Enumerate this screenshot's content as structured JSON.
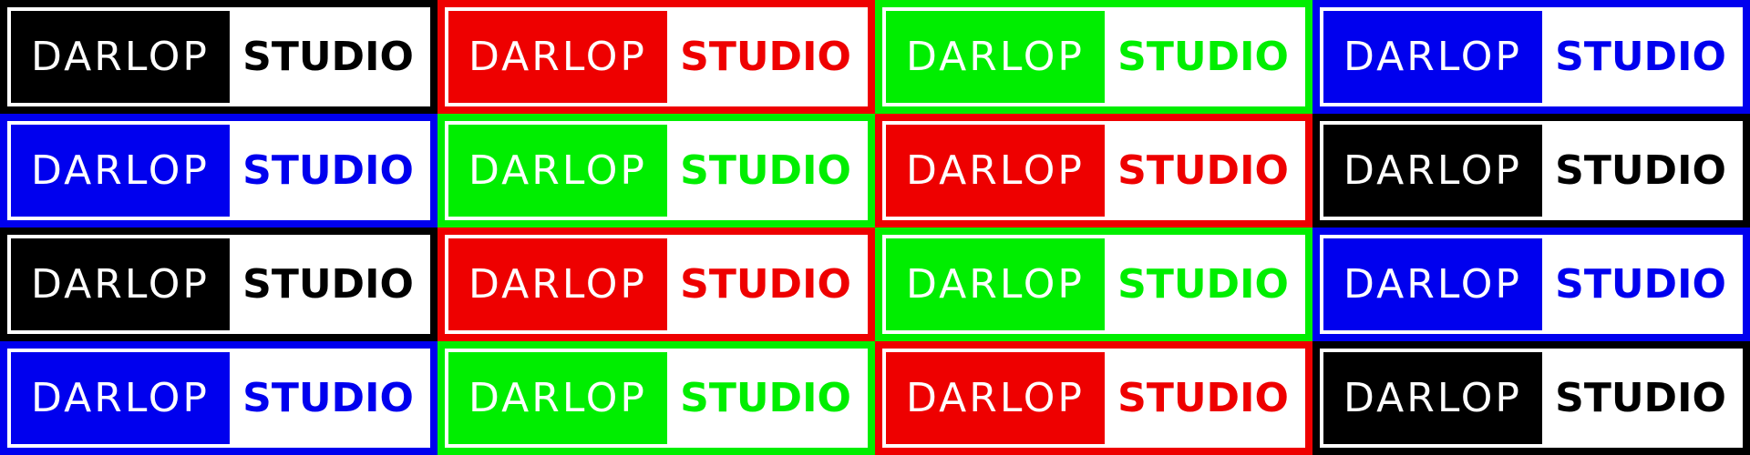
{
  "colors": {
    "black": "#000000",
    "red": "#ee0000",
    "green": "#00ee00",
    "blue": "#0000ee"
  },
  "logos": [
    {
      "word_left": "DARLOP",
      "word_right": "STUDIO",
      "color": "black"
    },
    {
      "word_left": "DARLOP",
      "word_right": "STUDIO",
      "color": "red"
    },
    {
      "word_left": "DARLOP",
      "word_right": "STUDIO",
      "color": "green"
    },
    {
      "word_left": "DARLOP",
      "word_right": "STUDIO",
      "color": "blue"
    },
    {
      "word_left": "DARLOP",
      "word_right": "STUDIO",
      "color": "blue"
    },
    {
      "word_left": "DARLOP",
      "word_right": "STUDIO",
      "color": "green"
    },
    {
      "word_left": "DARLOP",
      "word_right": "STUDIO",
      "color": "red"
    },
    {
      "word_left": "DARLOP",
      "word_right": "STUDIO",
      "color": "black"
    },
    {
      "word_left": "DARLOP",
      "word_right": "STUDIO",
      "color": "black"
    },
    {
      "word_left": "DARLOP",
      "word_right": "STUDIO",
      "color": "red"
    },
    {
      "word_left": "DARLOP",
      "word_right": "STUDIO",
      "color": "green"
    },
    {
      "word_left": "DARLOP",
      "word_right": "STUDIO",
      "color": "blue"
    },
    {
      "word_left": "DARLOP",
      "word_right": "STUDIO",
      "color": "blue"
    },
    {
      "word_left": "DARLOP",
      "word_right": "STUDIO",
      "color": "green"
    },
    {
      "word_left": "DARLOP",
      "word_right": "STUDIO",
      "color": "red"
    },
    {
      "word_left": "DARLOP",
      "word_right": "STUDIO",
      "color": "black"
    }
  ]
}
